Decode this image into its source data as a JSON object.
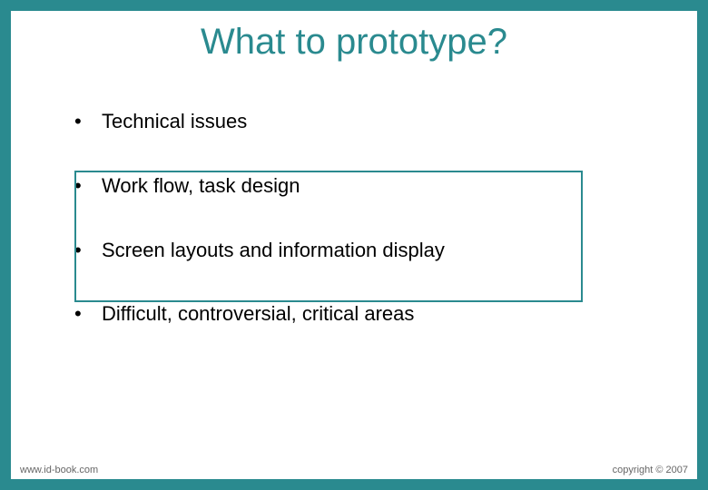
{
  "slide": {
    "title": "What to prototype?",
    "bullets": [
      "Technical issues",
      "Work flow, task design",
      "Screen layouts and information display",
      "Difficult, controversial, critical areas"
    ],
    "footer": {
      "left": "www.id-book.com",
      "right": "copyright © 2007"
    },
    "accent_color": "#2a8a8f"
  }
}
